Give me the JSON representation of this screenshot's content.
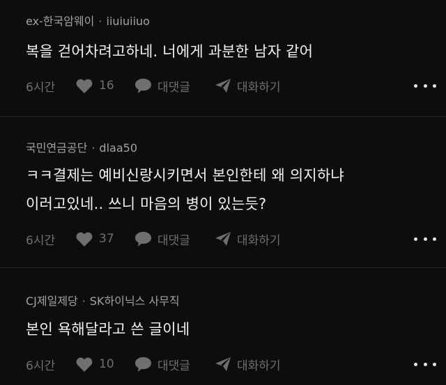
{
  "comments": [
    {
      "company": "ex-한국암웨이",
      "username": "iiuiuiiuo",
      "lines": [
        "복을 걷어차려고하네. 너에게 과분한 남자 같어"
      ],
      "time": "6시간",
      "likes": "16",
      "reply_label": "대댓글",
      "chat_label": "대화하기"
    },
    {
      "company": "국민연금공단",
      "username": "dlaa50",
      "lines": [
        "ㅋㅋ결제는 예비신랑시키면서 본인한테 왜 의지하냐",
        "이러고있네..  쓰니 마음의 병이 있는듯?"
      ],
      "time": "6시간",
      "likes": "37",
      "reply_label": "대댓글",
      "chat_label": "대화하기"
    },
    {
      "company": "CJ제일제당",
      "username": "SK하이닉스 사무직",
      "lines": [
        "본인 욕해달라고 쓴 글이네"
      ],
      "time": "6시간",
      "likes": "10",
      "reply_label": "대댓글",
      "chat_label": "대화하기"
    }
  ],
  "separator": "·",
  "icons": {
    "like": "heart-icon",
    "reply": "speech-bubble-icon",
    "chat": "paper-plane-icon",
    "more": "more-dots-icon"
  },
  "colors": {
    "background": "#0d0d0d",
    "text": "#f2f2f2",
    "meta": "#a2a2a2",
    "muted": "#6f6f6f"
  }
}
